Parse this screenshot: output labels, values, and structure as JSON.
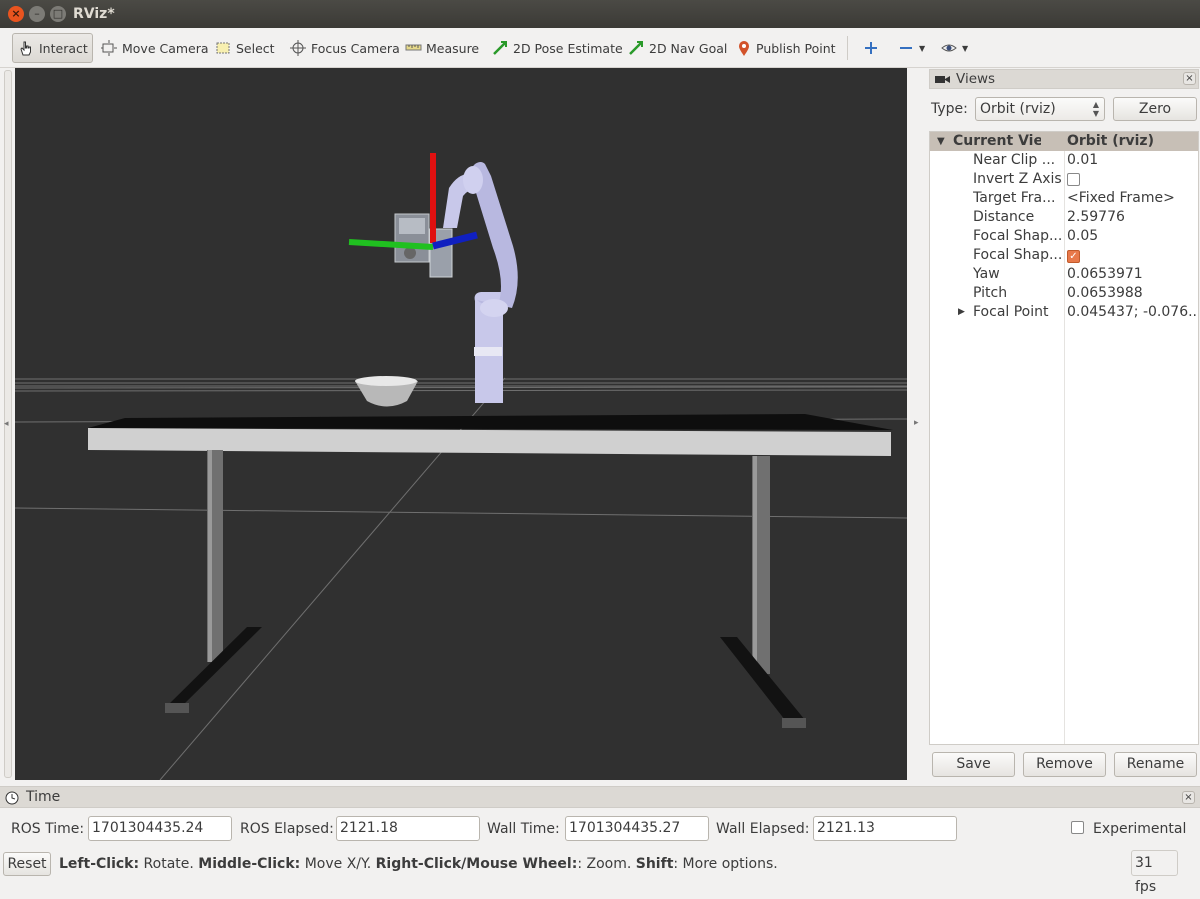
{
  "window": {
    "title": "RViz*"
  },
  "toolbar": {
    "tools": [
      {
        "label": "Interact"
      },
      {
        "label": "Move Camera"
      },
      {
        "label": "Select"
      },
      {
        "label": "Focus Camera"
      },
      {
        "label": "Measure"
      },
      {
        "label": "2D Pose Estimate"
      },
      {
        "label": "2D Nav Goal"
      },
      {
        "label": "Publish Point"
      }
    ]
  },
  "views": {
    "title": "Views",
    "type_label": "Type:",
    "type_value": "Orbit (rviz)",
    "zero_button": "Zero",
    "header": {
      "key": "Current View",
      "value": "Orbit (rviz)"
    },
    "properties": [
      {
        "key": "Near Clip ...",
        "value": "0.01"
      },
      {
        "key": "Invert Z Axis",
        "value": ""
      },
      {
        "key": "Target Fra...",
        "value": "<Fixed Frame>"
      },
      {
        "key": "Distance",
        "value": "2.59776"
      },
      {
        "key": "Focal Shap...",
        "value": "0.05"
      },
      {
        "key": "Focal Shap...",
        "value": ""
      },
      {
        "key": "Yaw",
        "value": "0.0653971"
      },
      {
        "key": "Pitch",
        "value": "0.0653988"
      },
      {
        "key": "Focal Point",
        "value": "0.045437; -0.076..."
      }
    ],
    "invert_z_checked": false,
    "focal_shape_checked": true,
    "save_button": "Save",
    "remove_button": "Remove",
    "rename_button": "Rename"
  },
  "time": {
    "title": "Time",
    "ros_time_label": "ROS Time:",
    "ros_time": "1701304435.24",
    "ros_elapsed_label": "ROS Elapsed:",
    "ros_elapsed": "2121.18",
    "wall_time_label": "Wall Time:",
    "wall_time": "1701304435.27",
    "wall_elapsed_label": "Wall Elapsed:",
    "wall_elapsed": "2121.13",
    "experimental_label": "Experimental"
  },
  "status": {
    "reset_button": "Reset",
    "left_click": "Left-Click:",
    "left_click_desc": " Rotate. ",
    "middle_click": "Middle-Click:",
    "middle_click_desc": " Move X/Y. ",
    "right_click": "Right-Click/Mouse Wheel:",
    "right_click_desc": ": Zoom. ",
    "shift": "Shift",
    "shift_desc": ": More options.",
    "fps": "31 fps"
  },
  "colors": {
    "viewport_bg": "#303030",
    "robot_arm": "#c8c8ea",
    "axis_x": "#e01010",
    "axis_y": "#20c020",
    "axis_z": "#1020c0",
    "table_top": "#d0d0d0"
  }
}
